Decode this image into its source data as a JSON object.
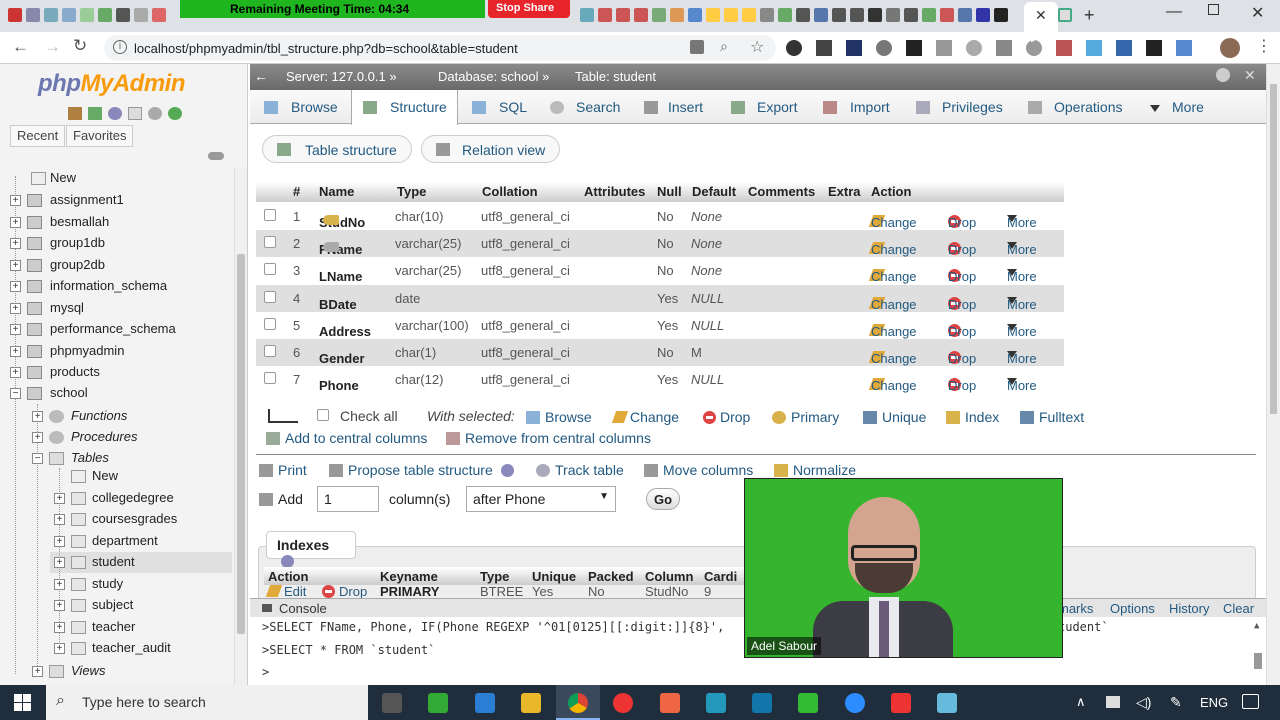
{
  "browser": {
    "meeting_time": "Remaining Meeting Time: 04:34",
    "stop_share": "Stop Share",
    "url": "localhost/phpmyadmin/tbl_structure.php?db=school&table=student"
  },
  "sidebar": {
    "logo_php": "php",
    "logo_admin": "MyAdmin",
    "recent": "Recent",
    "favorites": "Favorites",
    "tree": [
      {
        "label": "New",
        "level": 0
      },
      {
        "label": "assignment1",
        "level": 0
      },
      {
        "label": "besmallah",
        "level": 0
      },
      {
        "label": "group1db",
        "level": 0
      },
      {
        "label": "group2db",
        "level": 0
      },
      {
        "label": "information_schema",
        "level": 0
      },
      {
        "label": "mysql",
        "level": 0
      },
      {
        "label": "performance_schema",
        "level": 0
      },
      {
        "label": "phpmyadmin",
        "level": 0
      },
      {
        "label": "products",
        "level": 0
      },
      {
        "label": "school",
        "level": 0
      },
      {
        "label": "Functions",
        "level": 1
      },
      {
        "label": "Procedures",
        "level": 1
      },
      {
        "label": "Tables",
        "level": 1
      },
      {
        "label": "New",
        "level": 2
      },
      {
        "label": "collegedegree",
        "level": 2
      },
      {
        "label": "coursesgrades",
        "level": 2
      },
      {
        "label": "department",
        "level": 2
      },
      {
        "label": "student",
        "level": 2
      },
      {
        "label": "study",
        "level": 2
      },
      {
        "label": "subject",
        "level": 2
      },
      {
        "label": "teacher",
        "level": 2
      },
      {
        "label": "teacher_audit",
        "level": 2
      },
      {
        "label": "Views",
        "level": 1
      }
    ]
  },
  "breadcrumb": {
    "server": "Server: 127.0.0.1 »",
    "database": "Database: school »",
    "table": "Table: student"
  },
  "tabs": [
    "Browse",
    "Structure",
    "SQL",
    "Search",
    "Insert",
    "Export",
    "Import",
    "Privileges",
    "Operations",
    "More"
  ],
  "subtabs": [
    "Table structure",
    "Relation view"
  ],
  "table": {
    "headers": [
      "#",
      "Name",
      "Type",
      "Collation",
      "Attributes",
      "Null",
      "Default",
      "Comments",
      "Extra",
      "Action"
    ],
    "rows": [
      {
        "num": "1",
        "name": "StudNo",
        "type": "char(10)",
        "collation": "utf8_general_ci",
        "null": "No",
        "default": "None"
      },
      {
        "num": "2",
        "name": "FName",
        "type": "varchar(25)",
        "collation": "utf8_general_ci",
        "null": "No",
        "default": "None"
      },
      {
        "num": "3",
        "name": "LName",
        "type": "varchar(25)",
        "collation": "utf8_general_ci",
        "null": "No",
        "default": "None"
      },
      {
        "num": "4",
        "name": "BDate",
        "type": "date",
        "collation": "",
        "null": "Yes",
        "default": "NULL"
      },
      {
        "num": "5",
        "name": "Address",
        "type": "varchar(100)",
        "collation": "utf8_general_ci",
        "null": "Yes",
        "default": "NULL"
      },
      {
        "num": "6",
        "name": "Gender",
        "type": "char(1)",
        "collation": "utf8_general_ci",
        "null": "No",
        "default": "M"
      },
      {
        "num": "7",
        "name": "Phone",
        "type": "char(12)",
        "collation": "utf8_general_ci",
        "null": "Yes",
        "default": "NULL"
      }
    ],
    "action_change": "Change",
    "action_drop": "Drop",
    "action_more": "More"
  },
  "with_selected": {
    "check_all": "Check all",
    "label": "With selected:",
    "actions": [
      "Browse",
      "Change",
      "Drop",
      "Primary",
      "Unique",
      "Index",
      "Fulltext"
    ],
    "add_central": "Add to central columns",
    "remove_central": "Remove from central columns"
  },
  "tools": {
    "print": "Print",
    "propose": "Propose table structure",
    "track": "Track table",
    "move": "Move columns",
    "normalize": "Normalize",
    "add": "Add",
    "add_count": "1",
    "columns_label": "column(s)",
    "position": "after Phone",
    "go": "Go"
  },
  "indexes": {
    "title": "Indexes",
    "headers": [
      "Action",
      "Keyname",
      "Type",
      "Unique",
      "Packed",
      "Column",
      "Cardi"
    ],
    "row": {
      "edit": "Edit",
      "drop": "Drop",
      "keyname": "PRIMARY",
      "type": "BTREE",
      "unique": "Yes",
      "packed": "No",
      "column": "StudNo",
      "cardinality": "9"
    }
  },
  "console": {
    "title": "Console",
    "links": [
      "marks",
      "Options",
      "History",
      "Clear"
    ],
    "lines": [
      ">SELECT FName, Phone, IF(Phone REGEXP '^01[0125][[:digit:]]{8}',",
      ">SELECT * FROM `student`",
      ">"
    ],
    "line1_tail": "tudent`"
  },
  "webcam": {
    "name": "Adel Sabour"
  },
  "taskbar": {
    "search": "Type here to search",
    "lang": "ENG"
  }
}
